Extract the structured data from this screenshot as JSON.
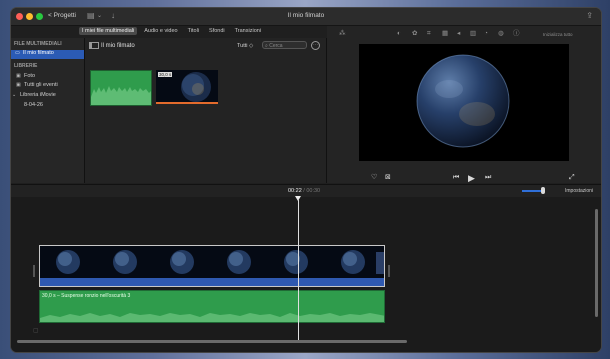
{
  "titlebar": {
    "back_label": "< Progetti",
    "title": "Il mio filmato"
  },
  "tabs": [
    {
      "label": "I miei file multimediali",
      "active": true
    },
    {
      "label": "Audio e video",
      "active": false
    },
    {
      "label": "Titoli",
      "active": false
    },
    {
      "label": "Sfondi",
      "active": false
    },
    {
      "label": "Transizioni",
      "active": false
    }
  ],
  "sidebar": {
    "media_header": "FILE MULTIMEDIALI",
    "project_item": "Il mio filmato",
    "libraries_header": "LIBRERIE",
    "photos_item": "Foto",
    "all_events_item": "Tutti gli eventi",
    "library_item": "Libreria iMovie",
    "event_item": "8-04-26"
  },
  "browser": {
    "title": "Il mio filmato",
    "filter": "Tutti ◇",
    "search_placeholder": "Cerca",
    "video_duration": "30,0 s"
  },
  "viewer": {
    "reset_all": "Inizializza tutto"
  },
  "timeline": {
    "current_time": "00:22",
    "total_time": "/ 00:30",
    "settings_label": "Impostazioni",
    "audio_clip_label": "30,0 s – Suspense ronzio nell'oscurità 3"
  },
  "colors": {
    "selection": "#2b5bb5",
    "audio_green": "#2f9c4c",
    "video_strip_blue": "#2f59b0",
    "zoom_blue": "#2f6fd8"
  },
  "icons": {
    "media_library_toggle": "sidebar-toggle-icon",
    "import": "import-arrow-icon",
    "share": "share-icon",
    "favorite": "heart-icon",
    "reject": "reject-icon",
    "fullscreen": "expand-arrows-icon"
  }
}
